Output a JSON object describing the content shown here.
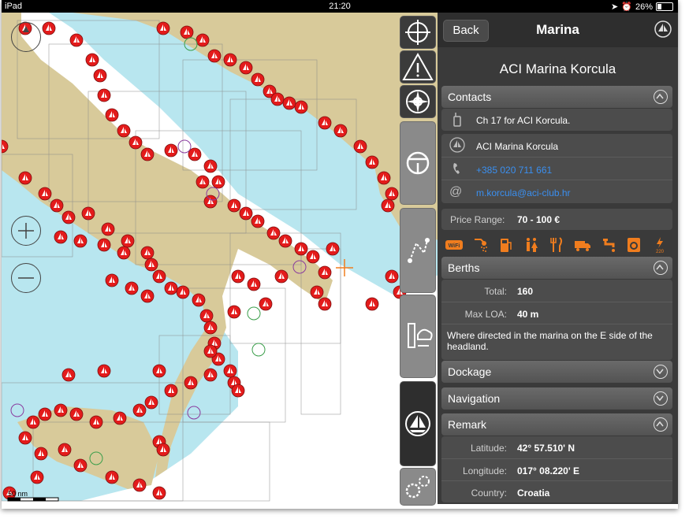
{
  "status": {
    "device": "iPad",
    "time": "21:20",
    "battery": "26%",
    "battery_level": 0.26
  },
  "map": {
    "scale_label": "50 nm"
  },
  "panel": {
    "back_label": "Back",
    "title": "Marina",
    "marina_name": "ACI Marina Korcula",
    "contacts": {
      "label": "Contacts",
      "vhf": "Ch 17 for ACI Korcula.",
      "name": "ACI Marina Korcula",
      "phone": "+385 020 711 661",
      "email": "m.korcula@aci-club.hr"
    },
    "price": {
      "label": "Price Range:",
      "value": "70 - 100 €"
    },
    "amenities": [
      "wifi-icon",
      "shower-icon",
      "fuel-icon",
      "toilet-icon",
      "restaurant-icon",
      "truck-icon",
      "water-tap-icon",
      "laundry-icon",
      "electricity-icon"
    ],
    "amenity_power": "220",
    "berths": {
      "label": "Berths",
      "total_label": "Total:",
      "total": "160",
      "maxloa_label": "Max LOA:",
      "maxloa": "40 m",
      "note": "Where directed in the marina on the E side of the headland."
    },
    "dockage": "Dockage",
    "navigation": "Navigation",
    "remark": {
      "label": "Remark",
      "lat_label": "Latitude:",
      "lat": "42° 57.510' N",
      "lon_label": "Longitude:",
      "lon": "017° 08.220' E",
      "country_label": "Country:",
      "country": "Croatia"
    }
  },
  "colors": {
    "land": "#d8ca9a",
    "shallow": "#b8e6ef",
    "panel": "#3a3a3a",
    "marker": "#e31b1b",
    "link": "#3a8ff0",
    "amenity": "#f07d1e"
  }
}
